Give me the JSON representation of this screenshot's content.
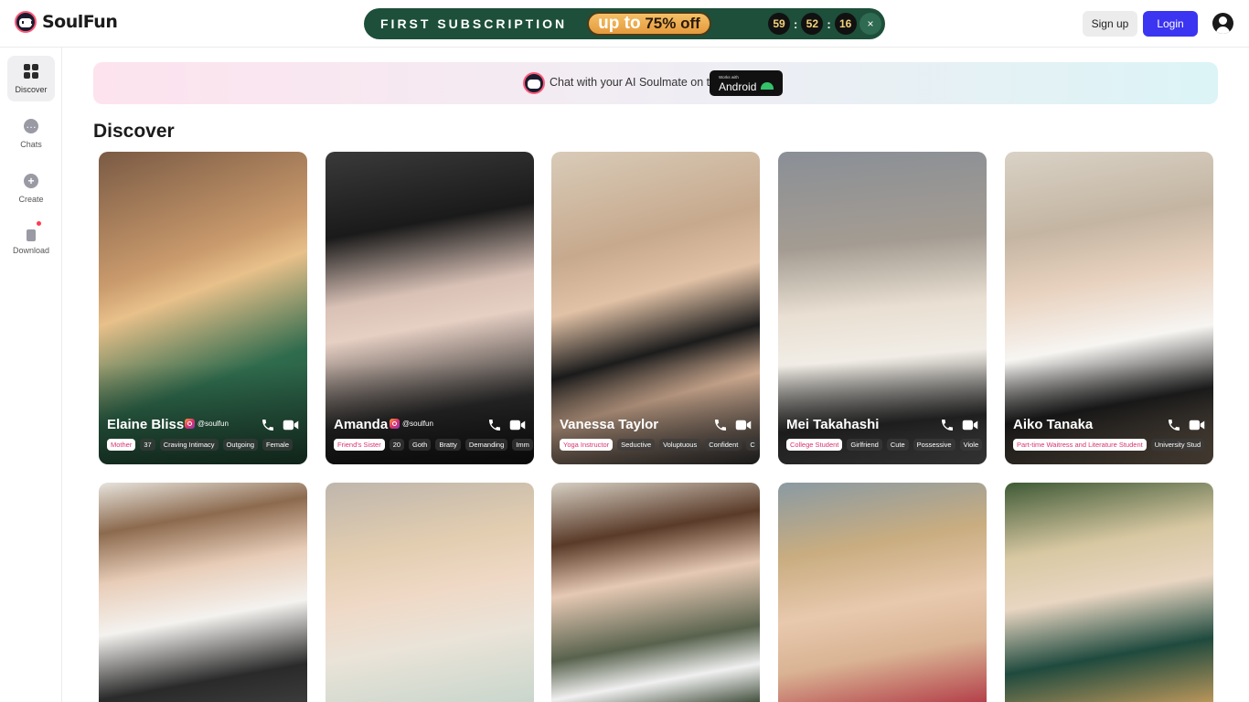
{
  "brand": {
    "name": "SoulFun"
  },
  "promo": {
    "title": "FIRST SUBSCRIPTION",
    "offer_prefix": "up to",
    "offer_value": "75% off",
    "timer": {
      "minutes": "59",
      "seconds": "52",
      "centis": "16",
      "sep1": ":",
      "sep2": ":"
    },
    "close": "×"
  },
  "header": {
    "signup": "Sign up",
    "login": "Login"
  },
  "sidebar": {
    "items": [
      {
        "label": "Discover",
        "icon": "grid-icon"
      },
      {
        "label": "Chats",
        "icon": "chat-icon"
      },
      {
        "label": "Create",
        "icon": "plus-circle-icon"
      },
      {
        "label": "Download",
        "icon": "phone-download-icon"
      }
    ]
  },
  "banner": {
    "text": "Chat with your AI Soulmate on the",
    "badge_small": "Works with",
    "badge_big": "Android"
  },
  "page_title": "Discover",
  "cards": [
    {
      "name": "Elaine Bliss",
      "handle": "@soulfun",
      "tags": [
        "Mother",
        "37",
        "Craving Intimacy",
        "Outgoing",
        "Female"
      ]
    },
    {
      "name": "Amanda",
      "handle": "@soulfun",
      "tags": [
        "Friend's Sister",
        "20",
        "Goth",
        "Bratty",
        "Demanding",
        "Imm"
      ]
    },
    {
      "name": "Vanessa Taylor",
      "tags": [
        "Yoga Instructor",
        "Seductive",
        "Voluptuous",
        "Confident",
        "C"
      ]
    },
    {
      "name": "Mei Takahashi",
      "tags": [
        "College Student",
        "Girlfriend",
        "Cute",
        "Possessive",
        "Viole"
      ]
    },
    {
      "name": "Aiko Tanaka",
      "tags": [
        "Part-time Waitress and Literature Student",
        "University Stud"
      ]
    }
  ],
  "colors": {
    "login_bg": "#3b34f0",
    "promo_bg": "#1d4f3a",
    "tag_accent": "#d8336f"
  }
}
